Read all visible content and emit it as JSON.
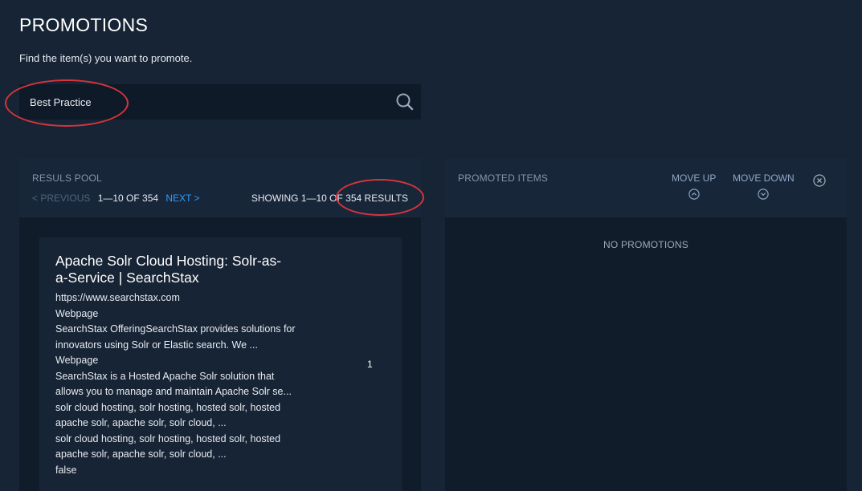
{
  "page": {
    "title": "PROMOTIONS",
    "subtitle": "Find the item(s) you want to promote."
  },
  "search": {
    "value": "Best Practice",
    "icon": "search-icon"
  },
  "results_pool": {
    "label": "RESULS POOL",
    "prev_label": "< PREVIOUS",
    "page_range": "1—10 OF 354",
    "next_label": "NEXT >",
    "showing_text": "SHOWING 1—10 OF 354 RESULTS",
    "results": [
      {
        "title": "Apache Solr Cloud Hosting: Solr-as-a-Service | SearchStax",
        "title_line1": "Apache Solr Cloud Hosting: Solr-as-",
        "title_line2": "a-Service | SearchStax",
        "lines": [
          "https://www.searchstax.com",
          "Webpage",
          "SearchStax OfferingSearchStax provides solutions for",
          "innovators using Solr or Elastic search. We ...",
          "Webpage",
          "SearchStax is a Hosted Apache Solr solution that",
          "allows you to manage and maintain Apache Solr se...",
          "solr cloud hosting, solr hosting, hosted solr, hosted",
          "apache solr, apache solr, solr cloud, ...",
          "solr cloud hosting, solr hosting, hosted solr, hosted",
          "apache solr, apache solr, solr cloud, ...",
          "false"
        ],
        "rank": "1"
      }
    ]
  },
  "promoted": {
    "label": "PROMOTED ITEMS",
    "move_up_label": "MOVE UP",
    "move_down_label": "MOVE DOWN",
    "empty_text": "NO PROMOTIONS"
  },
  "colors": {
    "background": "#172435",
    "panel": "#111c2a",
    "panel_header": "#18263a",
    "link_blue": "#2e9bff",
    "annotation_red": "#d6353b"
  }
}
